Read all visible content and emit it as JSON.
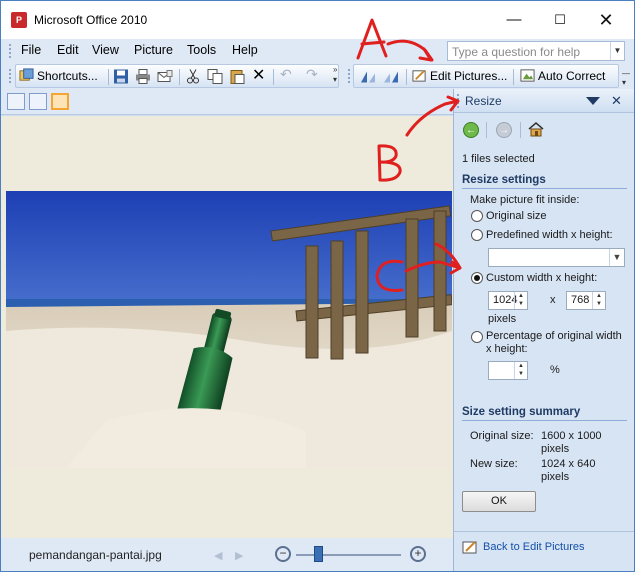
{
  "window": {
    "title": "Microsoft Office 2010"
  },
  "menu": [
    "File",
    "Edit",
    "View",
    "Picture",
    "Tools",
    "Help"
  ],
  "search": {
    "placeholder": "Type a question for help"
  },
  "toolbar": {
    "shortcuts": "Shortcuts...",
    "edit_pictures": "Edit Pictures...",
    "auto_correct": "Auto Correct"
  },
  "viewer": {
    "filename": "pemandangan-pantai.jpg"
  },
  "pane": {
    "title": "Resize",
    "files_selected": "1 files selected",
    "resize_heading": "Resize settings",
    "fit_label": "Make picture fit inside:",
    "options": [
      {
        "label": "Original size",
        "selected": false
      },
      {
        "label": "Predefined width x height:",
        "selected": false
      },
      {
        "label": "Custom width x height:",
        "selected": true
      },
      {
        "label": "Percentage of original width",
        "label2": "x height:",
        "selected": false
      }
    ],
    "predefined_value": "",
    "custom_width": "1024",
    "times": "x",
    "custom_height": "768",
    "pixels_label": "pixels",
    "percent_value": "",
    "percent_symbol": "%",
    "summary_heading": "Size setting summary",
    "original_label": "Original size:",
    "original_value": "1600 x 1000",
    "original_unit": "pixels",
    "new_label": "New size:",
    "new_value": "1024 x 640",
    "new_unit": "pixels",
    "ok": "OK",
    "back_link": "Back to Edit Pictures"
  },
  "annotations": [
    "A",
    "B",
    "C"
  ],
  "colors": {
    "accent": "#3b6fb5",
    "annotation": "#e0201f",
    "pane_bg": "#d7e4f4"
  }
}
